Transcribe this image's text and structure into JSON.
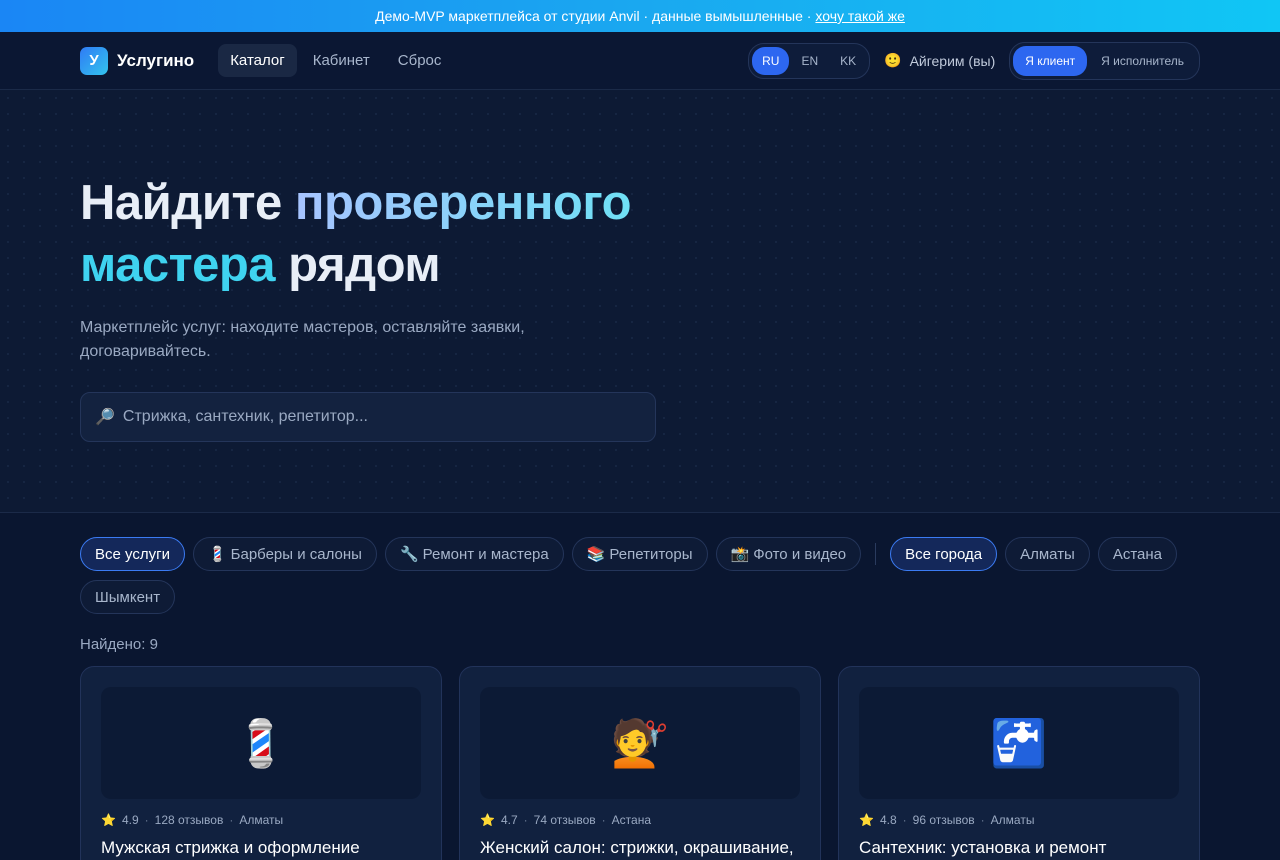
{
  "banner": {
    "text": "Демо-MVP маркетплейса от студии Anvil · данные вымышленные ·",
    "link": "хочу такой же"
  },
  "header": {
    "logo_mark": "У",
    "logo_text": "Услугино",
    "nav": [
      {
        "label": "Каталог",
        "active": true
      },
      {
        "label": "Кабинет",
        "active": false
      },
      {
        "label": "Сброс",
        "active": false
      }
    ],
    "languages": [
      {
        "label": "RU",
        "active": true
      },
      {
        "label": "EN",
        "active": false
      },
      {
        "label": "KK",
        "active": false
      }
    ],
    "user_emoji": "🙂",
    "user_name": "Айгерим (вы)",
    "roles": [
      {
        "label": "Я клиент",
        "active": true
      },
      {
        "label": "Я исполнитель",
        "active": false
      }
    ]
  },
  "hero": {
    "title_line1_start": "Найдите ",
    "title_line1_grad": "проверенного",
    "title_line2_accent": "мастера",
    "title_line2_rest": " рядом",
    "subtitle": "Маркетплейс услуг: находите мастеров, оставляйте заявки, договаривайтесь.",
    "search_icon": "🔎",
    "search_placeholder": "Стрижка, сантехник, репетитор..."
  },
  "filters": {
    "categories": [
      {
        "icon": "",
        "label": "Все услуги",
        "active": true
      },
      {
        "icon": "💈",
        "label": "Барберы и салоны",
        "active": false
      },
      {
        "icon": "🔧",
        "label": "Ремонт и мастера",
        "active": false
      },
      {
        "icon": "📚",
        "label": "Репетиторы",
        "active": false
      },
      {
        "icon": "📸",
        "label": "Фото и видео",
        "active": false
      }
    ],
    "cities": [
      {
        "label": "Все города",
        "active": true
      },
      {
        "label": "Алматы",
        "active": false
      },
      {
        "label": "Астана",
        "active": false
      },
      {
        "label": "Шымкент",
        "active": false
      }
    ]
  },
  "found": "Найдено: 9",
  "cards": [
    {
      "emoji": "💈",
      "rating": "4.9",
      "reviews": "128 отзывов",
      "city": "Алматы",
      "title": "Мужская стрижка и оформление"
    },
    {
      "emoji": "💇",
      "rating": "4.7",
      "reviews": "74 отзывов",
      "city": "Астана",
      "title": "Женский салон: стрижки, окрашивание,"
    },
    {
      "emoji": "🚰",
      "rating": "4.8",
      "reviews": "96 отзывов",
      "city": "Алматы",
      "title": "Сантехник: установка и ремонт"
    }
  ],
  "star_icon": "⭐"
}
